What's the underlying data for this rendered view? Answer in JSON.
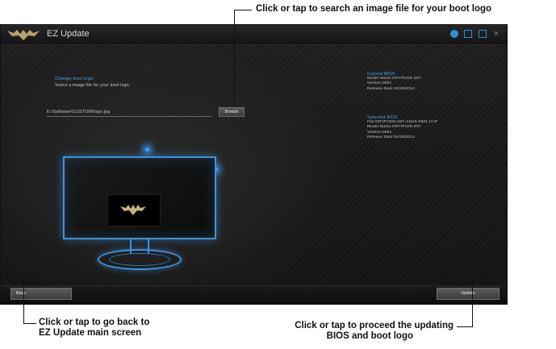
{
  "window": {
    "title": "EZ Update",
    "controls": [
      "gear-icon",
      "minimize-icon",
      "close-icon"
    ]
  },
  "left_panel": {
    "section_label": "Change boot logo",
    "section_desc": "Select a image file for your boot logo.",
    "file_path_value": "E:\\Software\\CUSTOM\\logo.jpg",
    "browse_label": "Browse"
  },
  "current_bios": {
    "heading": "Current BIOS",
    "model": "Model Name:GRYPHON Z97",
    "version": "Version:0801",
    "release": "Release Date:04/29/2014"
  },
  "selected_bios": {
    "heading": "Selected BIOS",
    "file": "File:GRYPHON-Z97-ASUS-0801.CAP",
    "model": "Model Name:GRYPHON Z97",
    "version": "Version:0801",
    "release": "Release Date:04/29/2014"
  },
  "buttons": {
    "back": "Back",
    "update": "Update"
  },
  "annotations": {
    "browse": "Click or tap to search an image file for your boot logo",
    "back_line1": "Click or tap to go back to",
    "back_line2": "EZ Update main screen",
    "update_line1": "Click or tap to proceed the updating",
    "update_line2": "BIOS and boot logo"
  },
  "colors": {
    "accent_blue": "#3d93e0",
    "window_bg": "#141414",
    "annotation_text": "#111111"
  }
}
